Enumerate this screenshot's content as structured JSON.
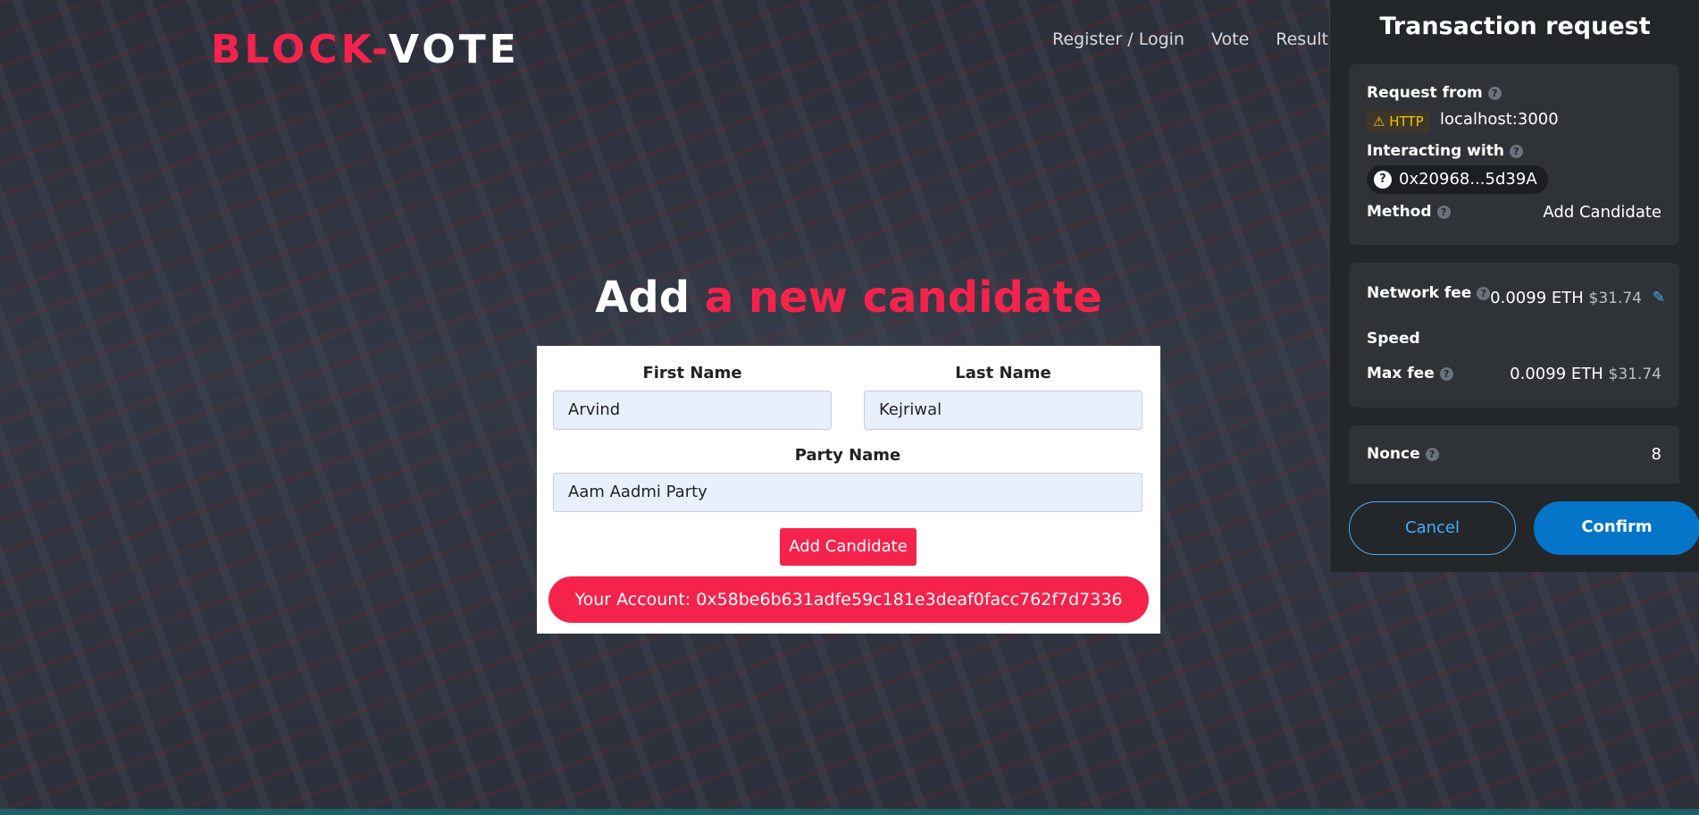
{
  "header": {
    "logo_part1": "BLOCK-",
    "logo_part2": "VOTE",
    "nav": [
      "Register / Login",
      "Vote",
      "Results"
    ]
  },
  "heading": {
    "part1": "Add",
    "part2": "a new candidate"
  },
  "form": {
    "first_name_label": "First Name",
    "first_name_value": "Arvind",
    "last_name_label": "Last Name",
    "last_name_value": "Kejriwal",
    "party_label": "Party Name",
    "party_value": "Aam Aadmi Party",
    "submit_label": "Add Candidate",
    "account_text": "Your Account: 0x58be6b631adfe59c181e3deaf0facc762f7d7336"
  },
  "metamask": {
    "title": "Transaction request",
    "request_from_label": "Request from",
    "http_badge": "HTTP",
    "origin": "localhost:3000",
    "interacting_label": "Interacting with",
    "contract_address": "0x20968...5d39A",
    "method_label": "Method",
    "method_value": "Add Candidate",
    "network_fee_label": "Network fee",
    "network_fee_eth": "0.0099 ETH",
    "network_fee_usd": "$31.74",
    "speed_label": "Speed",
    "max_fee_label": "Max fee",
    "max_fee_eth": "0.0099 ETH",
    "max_fee_usd": "$31.74",
    "nonce_label": "Nonce",
    "nonce_value": "8",
    "cancel_label": "Cancel",
    "confirm_label": "Confirm",
    "accent_color": "#0376c9",
    "warning_color": "#f8c000"
  },
  "theme": {
    "brand_color": "#f5234c"
  }
}
